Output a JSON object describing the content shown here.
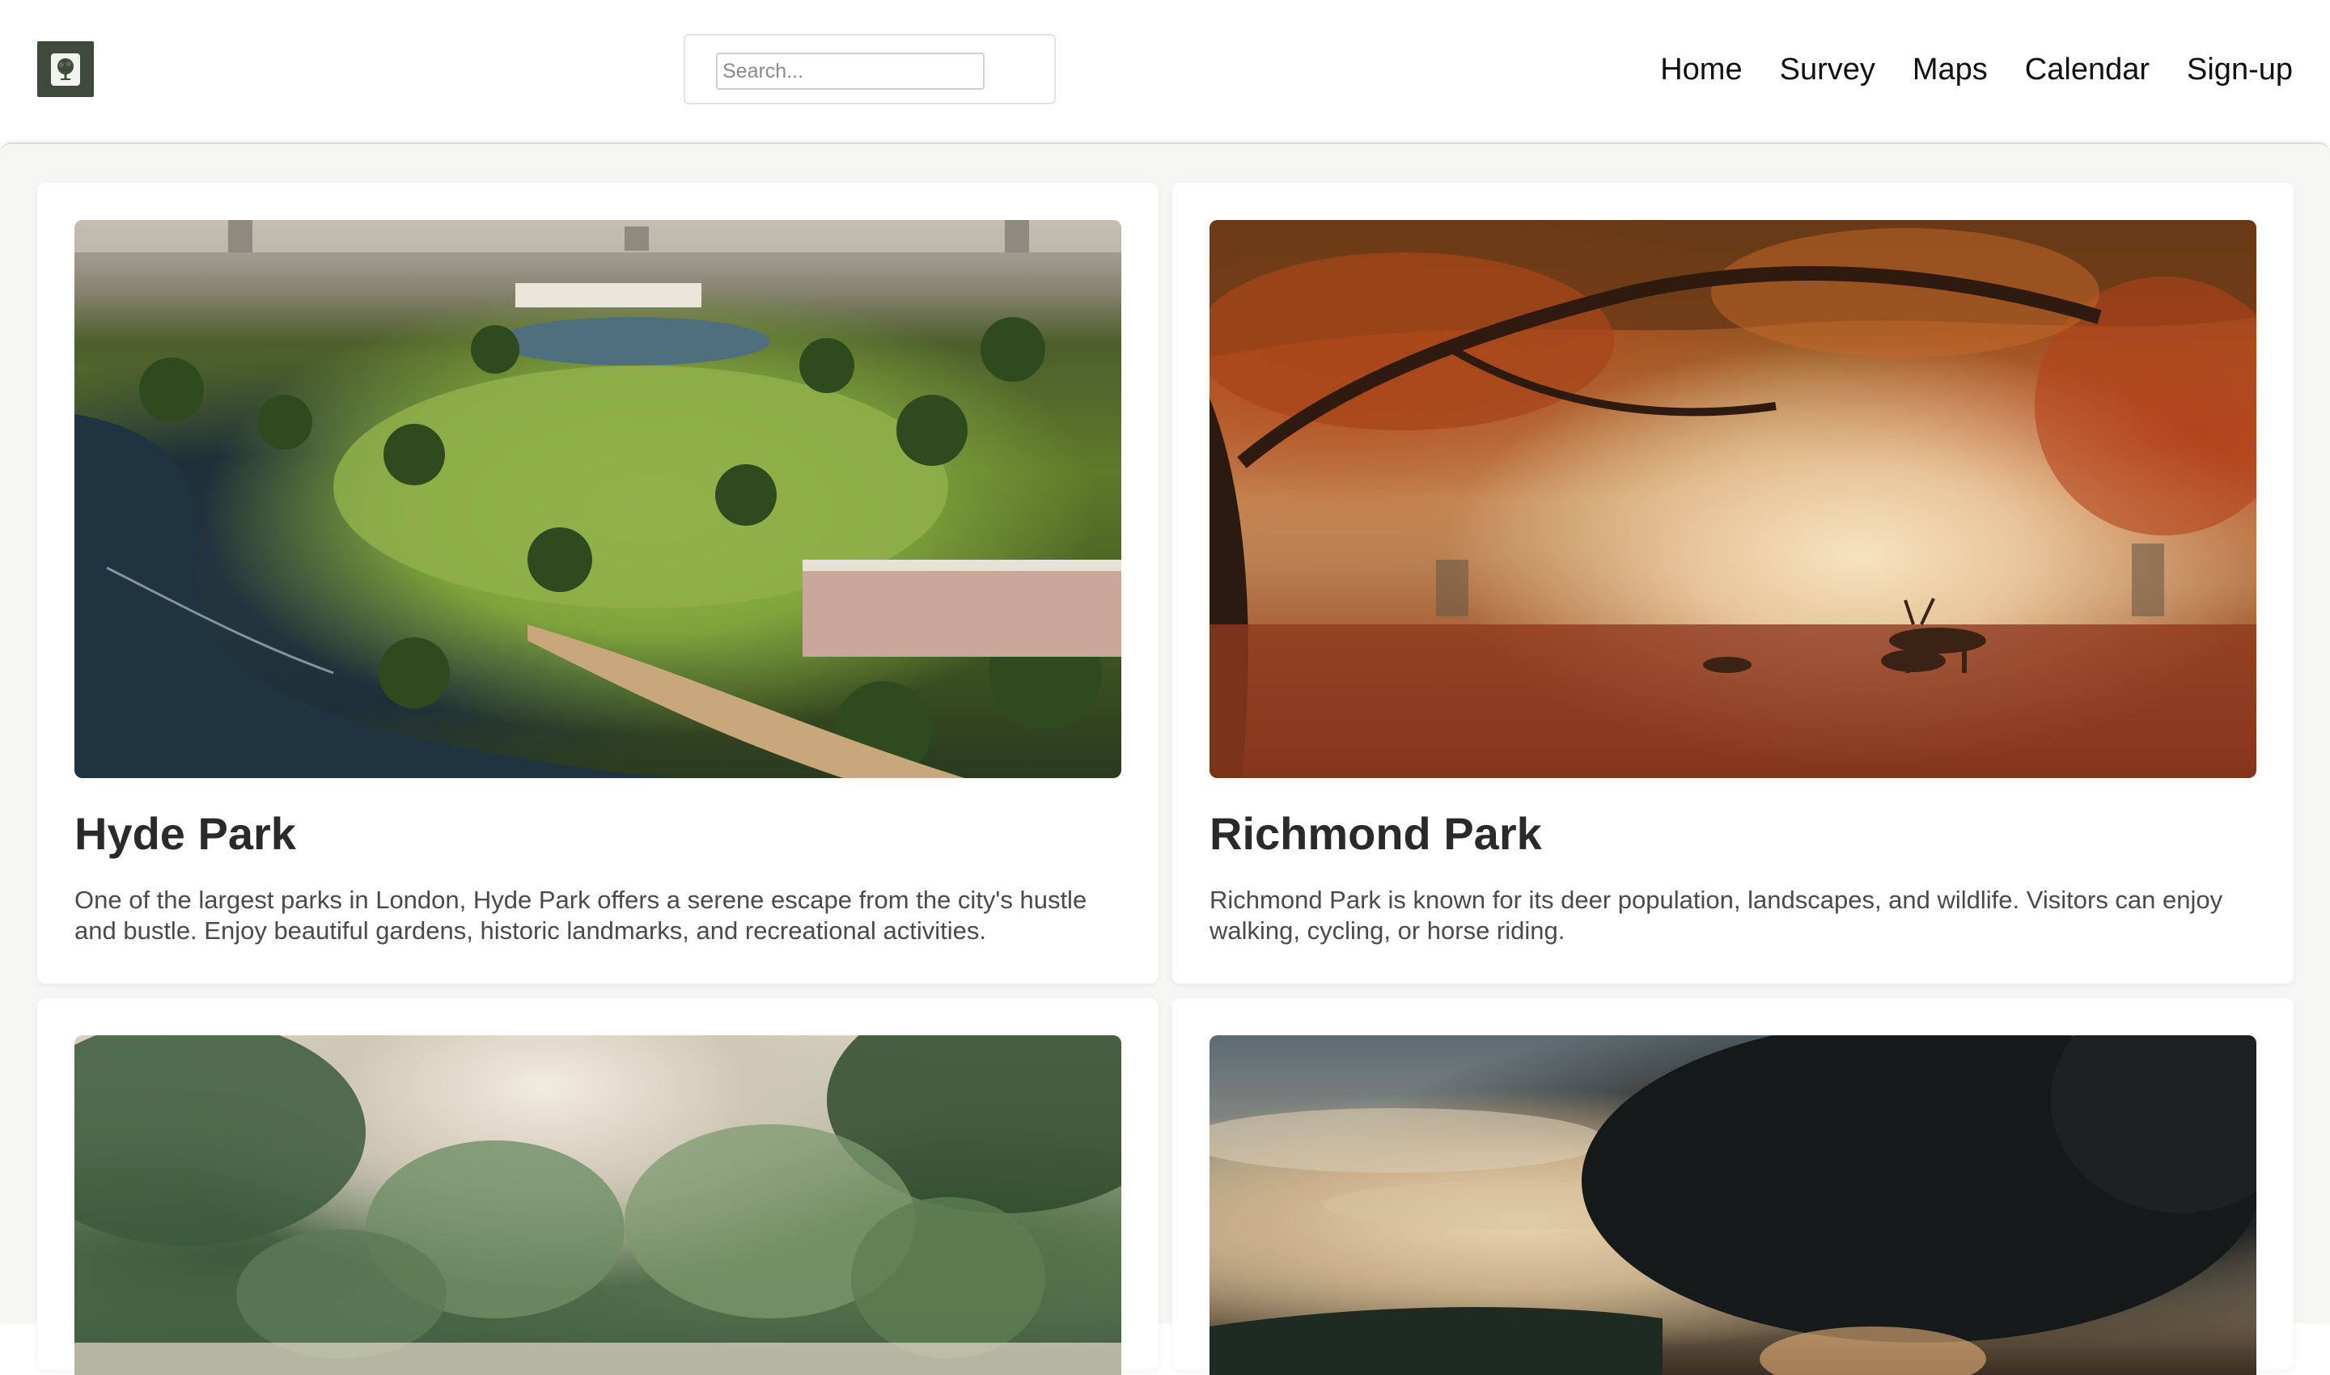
{
  "header": {
    "logo_icon": "tree-icon",
    "search": {
      "placeholder": "Search...",
      "value": ""
    },
    "nav": [
      "Home",
      "Survey",
      "Maps",
      "Calendar",
      "Sign-up"
    ]
  },
  "cards": [
    {
      "title": "Hyde Park",
      "description": "One of the largest parks in London, Hyde Park offers a serene escape from the city's hustle and bustle. Enjoy beautiful gardens, historic landmarks, and recreational activities."
    },
    {
      "title": "Richmond Park",
      "description": "Richmond Park is known for its deer population, landscapes, and wildlife. Visitors can enjoy walking, cycling, or horse riding."
    },
    {
      "title": "",
      "description": ""
    },
    {
      "title": "",
      "description": ""
    }
  ],
  "colors": {
    "logo_bg": "#3f4a3c",
    "page_bg": "#f6f6f4",
    "card_bg": "#ffffff",
    "title_text": "#2a2a2a",
    "body_text": "#4a4a4a"
  }
}
